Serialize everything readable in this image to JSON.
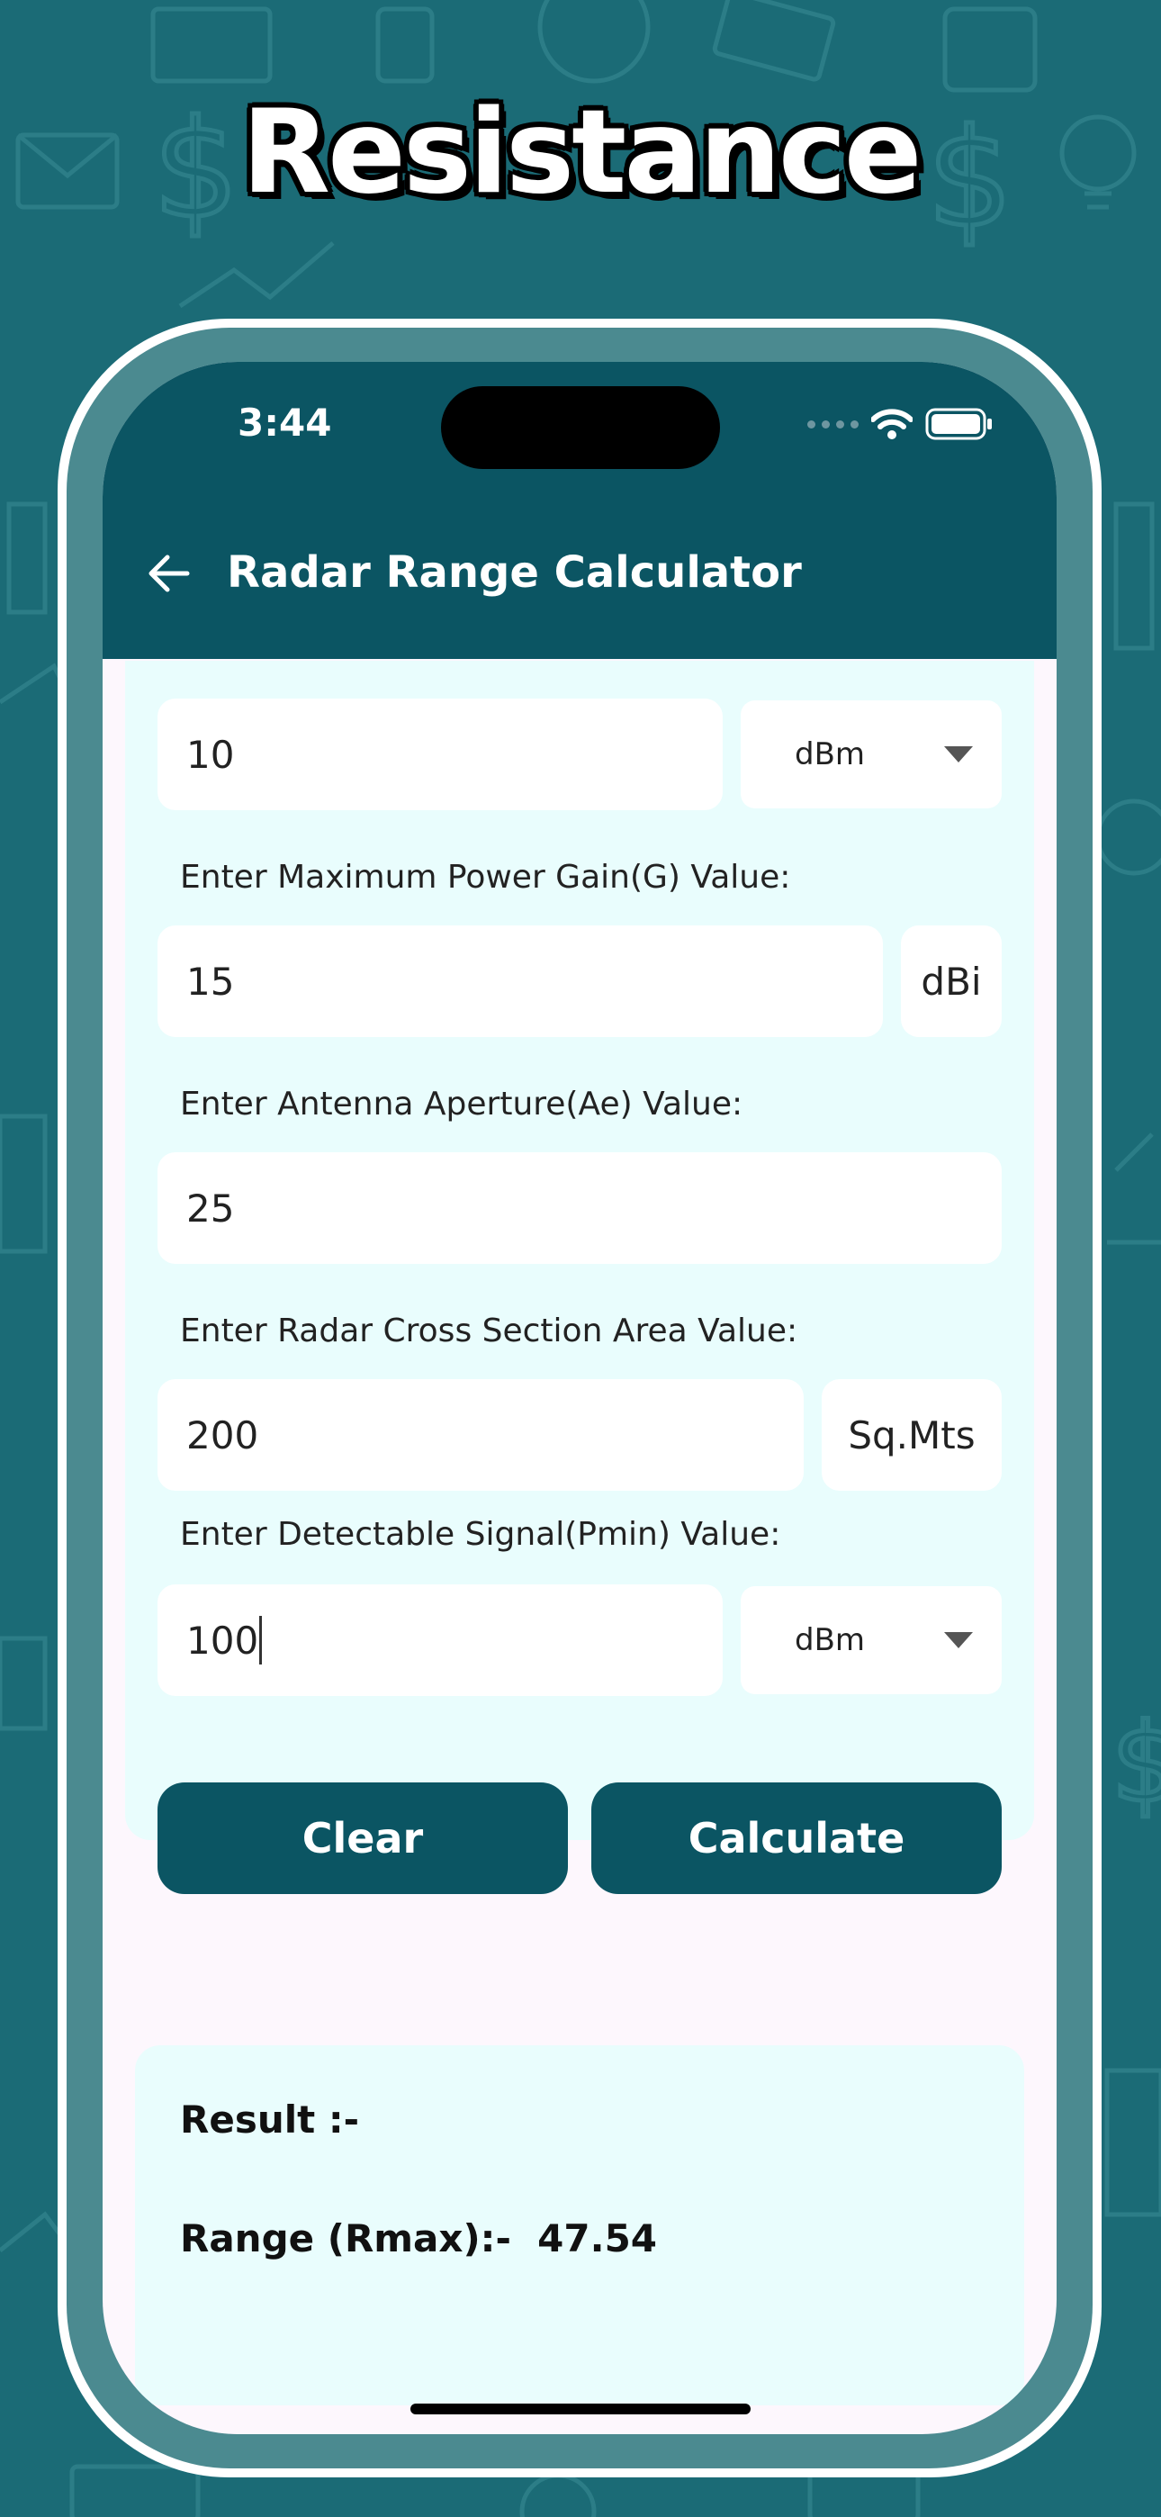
{
  "colors": {
    "background": "#1b6b76",
    "appbar": "#0b5563",
    "card": "#e9fdfd",
    "button": "#0b5563",
    "bezel": "#4b8a90"
  },
  "headline": "Resistance",
  "status_bar": {
    "time": "3:44",
    "icons": [
      "signal-dots-icon",
      "wifi-icon",
      "battery-icon"
    ]
  },
  "app_bar": {
    "back_icon": "arrow-left-icon",
    "title": "Radar Range Calculator"
  },
  "form": {
    "transmit_power": {
      "value": "10",
      "unit": "dBm"
    },
    "gain": {
      "label": "Enter Maximum Power Gain(G) Value:",
      "value": "15",
      "unit": "dBi"
    },
    "aperture": {
      "label": "Enter Antenna Aperture(Ae) Value:",
      "value": "25"
    },
    "cross_section": {
      "label": "Enter Radar Cross Section Area Value:",
      "value": "200",
      "unit": "Sq.Mts"
    },
    "min_signal": {
      "label": "Enter Detectable Signal(Pmin) Value:",
      "value": "100",
      "unit": "dBm"
    }
  },
  "buttons": {
    "clear": "Clear",
    "calculate": "Calculate"
  },
  "result": {
    "title": "Result :-",
    "range_label": "Range (Rmax):-",
    "range_value": "47.54"
  }
}
